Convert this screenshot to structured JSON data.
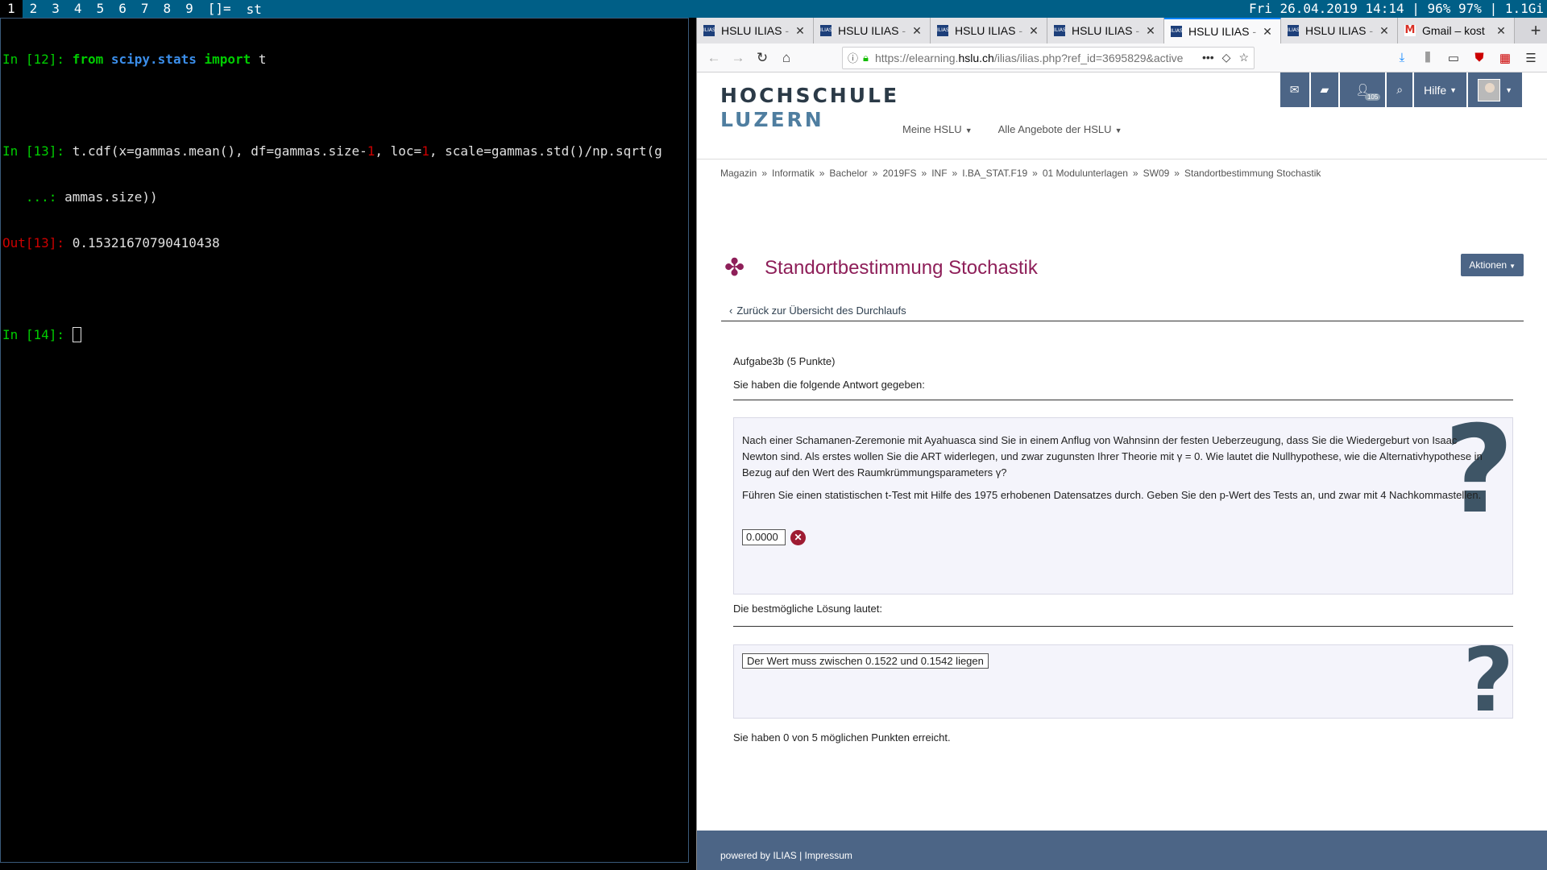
{
  "topbar": {
    "workspaces": [
      "1",
      "2",
      "3",
      "4",
      "5",
      "6",
      "7",
      "8",
      "9",
      "[]="
    ],
    "window_title": "st",
    "status": "Fri 26.04.2019 14:14 | 96% 97% | 1.1Gi"
  },
  "terminal": {
    "l1_prompt": "In [12]: ",
    "l1_from": "from ",
    "l1_mod": "scipy.stats",
    "l1_import": " import ",
    "l1_rest": "t",
    "l2_prompt": "In [13]: ",
    "l2_a": "t.cdf(x=gammas.mean(), df=gammas.size-",
    "l2_n1": "1",
    "l2_b": ", loc=",
    "l2_n2": "1",
    "l2_c": ", scale=gammas.std()/np.sqrt(g",
    "l3_cont": "   ...: ",
    "l3_a": "ammas.size))",
    "l4_prompt": "Out[13]: ",
    "l4_value": "0.15321670790410438",
    "l5_prompt": "In [14]: "
  },
  "browser": {
    "tabs": [
      {
        "title": "HSLU ILIAS",
        "fade": " -",
        "active": false
      },
      {
        "title": "HSLU ILIAS",
        "fade": " -",
        "active": false
      },
      {
        "title": "HSLU ILIAS",
        "fade": " -",
        "active": false
      },
      {
        "title": "HSLU ILIAS",
        "fade": " -",
        "active": false
      },
      {
        "title": "HSLU ILIAS",
        "fade": " -",
        "active": true
      },
      {
        "title": "HSLU ILIAS",
        "fade": " -",
        "active": false
      },
      {
        "title": "Gmail – kost",
        "fade": "",
        "active": false
      }
    ],
    "favicon_label": "ILIAS",
    "url_pre": "https://elearning.",
    "url_domain": "hslu.ch",
    "url_post": "/ilias/ilias.php?ref_id=3695829&active"
  },
  "page": {
    "logo_line1": "HOCHSCHULE",
    "logo_line2": "LUZERN",
    "menu": [
      "Meine HSLU",
      "Alle Angebote der HSLU"
    ],
    "help_label": "Hilfe",
    "badge_count": "105",
    "breadcrumb": [
      "Magazin",
      "Informatik",
      "Bachelor",
      "2019FS",
      "INF",
      "I.BA_STAT.F19",
      "01 Modulunterlagen",
      "SW09",
      "Standortbestimmung Stochastik"
    ],
    "breadcrumb_sep": "»",
    "title": "Standortbestimmung Stochastik",
    "actions_label": "Aktionen",
    "back_link": "Zurück zur Übersicht des Durchlaufs",
    "task_title": "Aufgabe3b (5 Punkte)",
    "answer_intro": "Sie haben die folgende Antwort gegeben:",
    "question_p1": "Nach einer Schamanen-Zeremonie mit Ayahuasca sind Sie in einem Anflug von Wahnsinn der festen Ueberzeugung, dass Sie die Wiedergeburt von Isaac Newton sind. Als erstes wollen Sie die ART widerlegen, und zwar zugunsten Ihrer Theorie mit γ = 0. Wie lautet die Nullhypothese, wie die Alternativhypothese in Bezug auf den Wert des Raumkrümmungsparameters γ?",
    "question_p2": "Führen Sie einen statistischen t-Test mit Hilfe des 1975 erhobenen Datensatzes durch. Geben Sie den p-Wert des Tests an, und zwar mit 4 Nachkommastellen.",
    "answer_value": "0.0000",
    "solution_intro": "Die bestmögliche Lösung lautet:",
    "solution_value": "Der Wert muss zwischen 0.1522 und 0.1542 liegen",
    "points": "Sie haben 0 von 5 möglichen Punkten erreicht.",
    "qmark": "?",
    "footer_powered": "powered by ILIAS",
    "footer_sep": " | ",
    "footer_impressum": "Impressum"
  },
  "colors": {
    "accent": "#8e1f59",
    "header_blue": "#4c6586",
    "topbar": "#005f87"
  }
}
